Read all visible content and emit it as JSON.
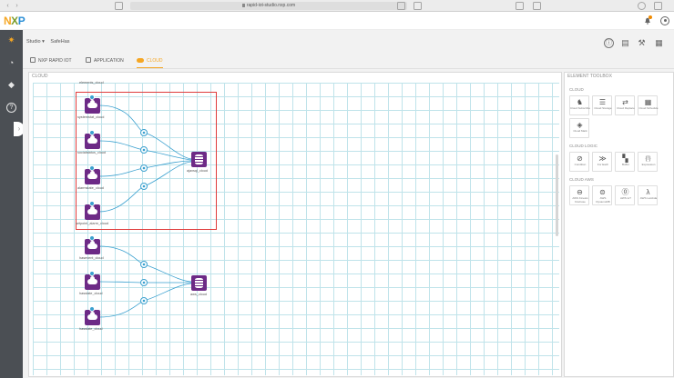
{
  "browser": {
    "url": "rapid-iot-studio.nxp.com",
    "back_glyph": "‹",
    "forward_glyph": "›"
  },
  "header": {
    "logo_parts": [
      "N",
      "X",
      "P"
    ]
  },
  "sidebar": {
    "items": [
      {
        "icon": "nodes-icon",
        "glyph": "✷"
      },
      {
        "icon": "dashboard-icon",
        "glyph": "◔"
      },
      {
        "icon": "box-icon",
        "glyph": "◆"
      },
      {
        "icon": "help-icon",
        "glyph": "?"
      }
    ],
    "toggle_glyph": "›"
  },
  "breadcrumb": {
    "studio": "Studio ▾",
    "project": "SafeHas"
  },
  "tools": {
    "info_glyph": "ⓘ",
    "save_glyph": "▤",
    "build_glyph": "⚒",
    "device_glyph": "▦"
  },
  "tabs": [
    {
      "label": "NXP RAPID IOT",
      "active": false
    },
    {
      "label": "APPLICATION",
      "active": false
    },
    {
      "label": "CLOUD",
      "active": true
    }
  ],
  "canvas": {
    "title": "CLOUD",
    "top_label": "elements_cloud",
    "group1_inputs": [
      "systemstat_cloud",
      "socialstatus_cloud",
      "alarmstate_cloud",
      "setpoint_alarm_cloud"
    ],
    "group1_output": "ajaxsql_cloud",
    "group2_inputs": [
      "hasevent_cloud",
      "hasstate_cloud",
      "hasstate_cloud"
    ],
    "group2_output": "aws_cloud"
  },
  "toolbox": {
    "title": "ELEMENT TOOLBOX",
    "sections": [
      {
        "name": "CLOUD",
        "items": [
          {
            "label": "Cloud Subscribe",
            "glyph": "♞",
            "icon": "bell-icon"
          },
          {
            "label": "Cloud Storage",
            "glyph": "☰",
            "icon": "database-icon"
          },
          {
            "label": "Cloud Replace",
            "glyph": "⇄",
            "icon": "replace-icon"
          },
          {
            "label": "Cloud Schedule",
            "glyph": "▦",
            "icon": "calendar-icon"
          },
          {
            "label": "Cloud Mark",
            "glyph": "◈",
            "icon": "tag-icon"
          }
        ]
      },
      {
        "name": "CLOUD LOGIC",
        "items": [
          {
            "label": "Condition",
            "glyph": "⊘",
            "icon": "condition-icon"
          },
          {
            "label": "For Each",
            "glyph": "≫",
            "icon": "foreach-icon"
          },
          {
            "label": "Buffer",
            "glyph": "▚",
            "icon": "buffer-icon"
          },
          {
            "label": "Expression",
            "glyph": "{!}",
            "icon": "expression-icon"
          }
        ]
      },
      {
        "name": "CLOUD AWS",
        "items": [
          {
            "label": "AWS Kinesis Firehose",
            "glyph": "⊖",
            "icon": "kinesis-icon"
          },
          {
            "label": "AWS DynamoDB",
            "glyph": "⊜",
            "icon": "dynamodb-icon"
          },
          {
            "label": "AWS IoT",
            "glyph": "⓪",
            "icon": "aws-iot-icon"
          },
          {
            "label": "AWS Lambda",
            "glyph": "λ",
            "icon": "lambda-icon"
          }
        ]
      }
    ]
  },
  "colors": {
    "accent": "#f5a623",
    "block": "#6d2a86",
    "wire": "#3aa0cf",
    "selection": "#e03c3c"
  }
}
